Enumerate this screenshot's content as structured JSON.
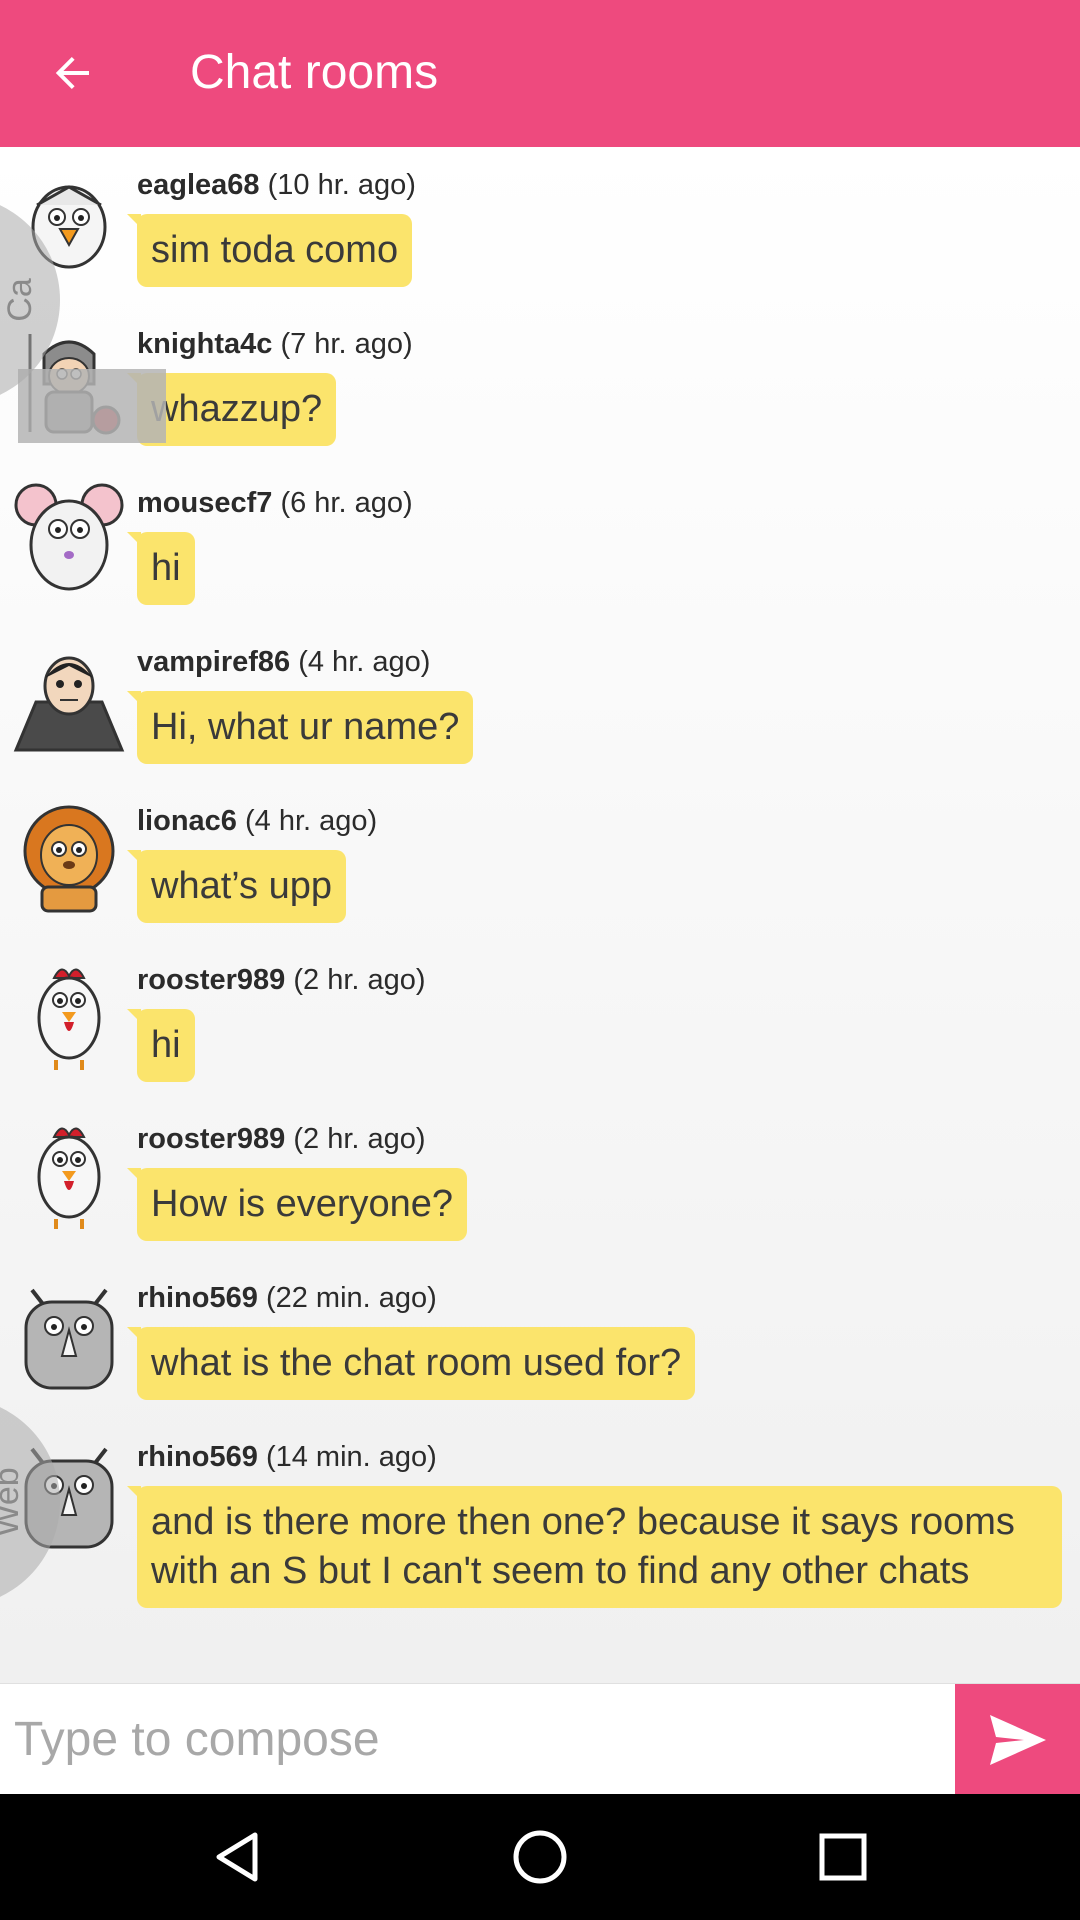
{
  "app_bar": {
    "title": "Chat rooms",
    "background_color": "#ee4a7e",
    "back_icon": "arrow-left-icon"
  },
  "messages": [
    {
      "avatar": "eagle-avatar",
      "username": "eaglea68",
      "time": "(10 hr. ago)",
      "text": "sim toda como"
    },
    {
      "avatar": "knight-avatar",
      "username": "knighta4c",
      "time": "(7 hr. ago)",
      "text": "whazzup?"
    },
    {
      "avatar": "mouse-avatar",
      "username": "mousecf7",
      "time": "(6 hr. ago)",
      "text": "hi"
    },
    {
      "avatar": "vampire-avatar",
      "username": "vampiref86",
      "time": "(4 hr. ago)",
      "text": "Hi, what ur name?"
    },
    {
      "avatar": "lion-avatar",
      "username": "lionac6",
      "time": "(4 hr. ago)",
      "text": "what’s upp"
    },
    {
      "avatar": "rooster-avatar",
      "username": "rooster989",
      "time": "(2 hr. ago)",
      "text": "hi"
    },
    {
      "avatar": "rooster-avatar",
      "username": "rooster989",
      "time": "(2 hr. ago)",
      "text": "How is everyone?"
    },
    {
      "avatar": "rhino-avatar",
      "username": "rhino569",
      "time": "(22 min. ago)",
      "text": "what is the chat room used for?"
    },
    {
      "avatar": "rhino-avatar",
      "username": "rhino569",
      "time": "(14 min. ago)",
      "text": "and is there more then one? because it says rooms with an S but I can't seem to find any other chats"
    }
  ],
  "side_tabs": {
    "top_label": "Ca",
    "bottom_label": "Web"
  },
  "composer": {
    "placeholder": "Type to compose",
    "send_icon": "send-icon"
  },
  "bubble_color": "#fbe46c",
  "nav_bar": {
    "back_icon": "nav-back-icon",
    "home_icon": "nav-home-icon",
    "recents_icon": "nav-recents-icon"
  }
}
